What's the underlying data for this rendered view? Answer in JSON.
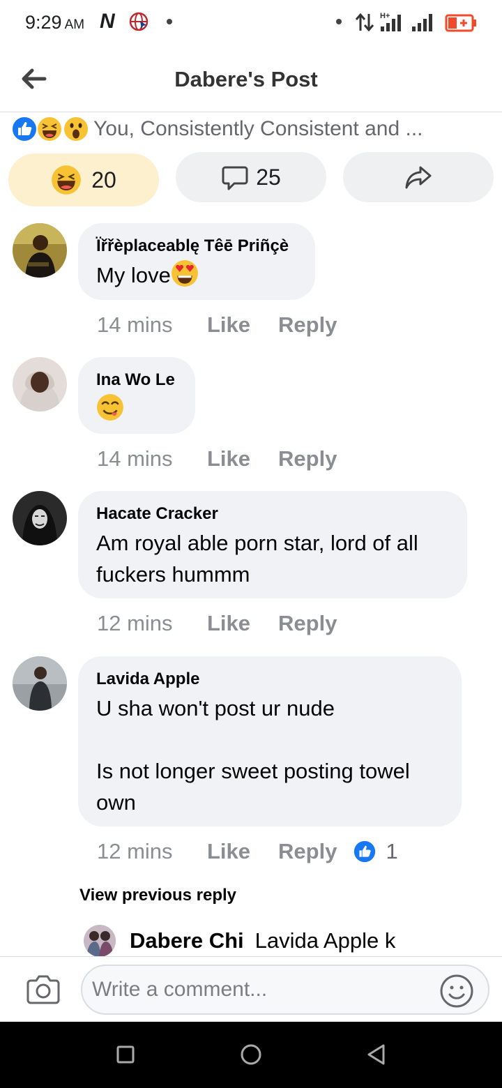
{
  "status_bar": {
    "time": "9:29",
    "ampm": "AM",
    "carrier_icon_letter": "N",
    "network_type": "H+",
    "battery_color": "#f04a2a"
  },
  "header": {
    "title": "Dabere's Post",
    "back_icon": "back-arrow-icon"
  },
  "reactions": {
    "icons": [
      "like-icon",
      "haha-icon",
      "wow-icon"
    ],
    "names": "You, Consistently Consistent and ..."
  },
  "actions": {
    "haha_count": "20",
    "comment_count": "25",
    "highlight_color": "#fdf0cf"
  },
  "comments": [
    {
      "name": "Ïřřèplaceablę Têē Priñçè",
      "text": "My love",
      "emoji": "heart-eyes-emoji",
      "time": "14 mins",
      "like": "Like",
      "reply": "Reply"
    },
    {
      "name": "Ina Wo Le",
      "text": "",
      "emoji": "yum-emoji",
      "time": "14 mins",
      "like": "Like",
      "reply": "Reply"
    },
    {
      "name": "Hacate Cracker",
      "text_lines": [
        "Am royal able porn star, lord of all",
        "fuckers hummm"
      ],
      "time": "12 mins",
      "like": "Like",
      "reply": "Reply"
    },
    {
      "name": "Lavida Apple",
      "text_lines": [
        "U sha won't post ur nude",
        "",
        "Is not longer sweet posting towel",
        "own"
      ],
      "time": "12 mins",
      "like": "Like",
      "reply": "Reply",
      "like_count": "1"
    }
  ],
  "view_previous": "View previous reply",
  "reply_preview": {
    "name": "Dabere Chi",
    "text": "Lavida Apple k"
  },
  "composer": {
    "placeholder": "Write a comment..."
  },
  "colors": {
    "fb_blue": "#1877f2",
    "bubble_bg": "#f0f2f5",
    "meta_gray": "#8a8d91"
  }
}
